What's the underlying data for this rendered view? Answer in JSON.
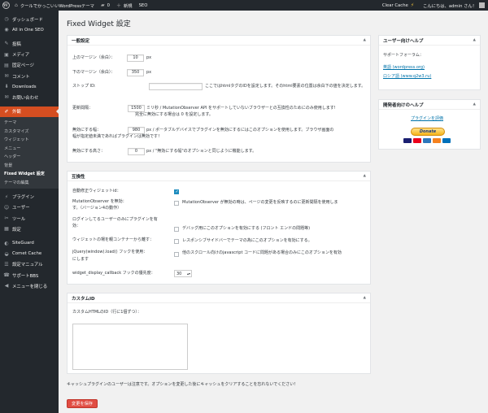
{
  "adminbar": {
    "wp_logo": "W",
    "site_name": "クールでかっこいいWordPressテーマ",
    "comments_count": "0",
    "new_label": "新規",
    "seo_label": "SEO",
    "clear_cache": "Clear Cache",
    "greeting": "こんにちは、admin さん！"
  },
  "sidebar": {
    "items": [
      {
        "label": "ダッシュボード",
        "icon": "dashboard-icon",
        "glyph": "◷"
      },
      {
        "label": "All in One SEO",
        "icon": "seo-icon",
        "glyph": "◉"
      },
      {
        "label": "投稿",
        "icon": "pin-icon",
        "glyph": "✎"
      },
      {
        "label": "メディア",
        "icon": "media-icon",
        "glyph": "▣"
      },
      {
        "label": "固定ページ",
        "icon": "page-icon",
        "glyph": "▤"
      },
      {
        "label": "コメント",
        "icon": "comment-icon",
        "glyph": "✉"
      },
      {
        "label": "Downloads",
        "icon": "download-icon",
        "glyph": "⬇"
      },
      {
        "label": "お問い合わせ",
        "icon": "mail-icon",
        "glyph": "✉"
      },
      {
        "label": "外観",
        "icon": "appearance-icon",
        "glyph": "✐"
      }
    ],
    "submenu": [
      "テーマ",
      "カスタマイズ",
      "ウィジェット",
      "メニュー",
      "ヘッダー",
      "背景",
      "Fixed Widget 設定",
      "テーマの編集"
    ],
    "items2": [
      {
        "label": "プラグイン",
        "icon": "plugin-icon",
        "glyph": "⚡"
      },
      {
        "label": "ユーザー",
        "icon": "user-icon",
        "glyph": "☺"
      },
      {
        "label": "ツール",
        "icon": "tool-icon",
        "glyph": "✂"
      },
      {
        "label": "設定",
        "icon": "settings-icon",
        "glyph": "▦"
      }
    ],
    "items3": [
      {
        "label": "SiteGuard",
        "icon": "siteguard-icon",
        "glyph": "◐"
      },
      {
        "label": "Comet Cache",
        "icon": "cache-icon",
        "glyph": "◒"
      },
      {
        "label": "設定マニュアル",
        "icon": "manual-icon",
        "glyph": "☰"
      },
      {
        "label": "サポートBBS",
        "icon": "support-icon",
        "glyph": "☎"
      },
      {
        "label": "メニューを閉じる",
        "icon": "collapse-icon",
        "glyph": "◀"
      }
    ]
  },
  "page_title": "Fixed Widget 設定",
  "general": {
    "title": "一般設定",
    "toggle": "▲",
    "margin_top_label": "上のマージン（余白）：",
    "margin_top_value": "10",
    "margin_bottom_label": "下のマージン（余白）：",
    "margin_bottom_value": "350",
    "px": "px",
    "stop_id_label": "ストップ ID:",
    "stop_id_value": "",
    "stop_id_desc": "ここではhtmlタグのIDを設定します。そのhtml要素の位置は余白下の値を決定します。",
    "refresh_label": "更新間隔：",
    "refresh_value": "1500",
    "refresh_desc": "ミリ秒 / MutationObserver API をサポートしていないブラウザーとの互換性のためにのみ使用します!",
    "refresh_desc2": "完全に無効にする場合は 0 を設定します。",
    "disable_width_label": "無効にする幅：",
    "disable_width_value": "980",
    "disable_width_desc": "px / ポータブルデバイスでプラグインを無効にするにはこのオプションを使用します。ブラウザ画面の",
    "disable_width_desc2": "幅が指定値未満であればプラグインは無効です！",
    "disable_height_label": "無効にする高さ：",
    "disable_height_value": "0",
    "disable_height_desc": "px / \"無効にする幅\"のオプションと同じように機能します。"
  },
  "compat": {
    "title": "互換性",
    "toggle": "▲",
    "auto_fix_label": "自動修正ウィジェットid：",
    "mutation_label": "MutationObserver を無効：",
    "mutation_label2": "す。（バージョン4の動作）",
    "mutation_desc": "MutationObserver が無効の時は、ページの変更を反映するのに更新間隔を使用しま",
    "logged_label": "ログインしてるユーザーのみにプラグインを有",
    "logged_label2": "効：",
    "logged_desc": "デバッグ用にこのオプションを有効にする (フロント エンドの問題等)",
    "reset_label": "ウィジェットの場を親コンテナーから離す：",
    "reset_desc": "レスポンシブサイドバーでテーマの為にこのオプションを有効にする。",
    "jquery_label": "jQuery(window).load() フックを使用：",
    "jquery_label2": "にします",
    "jquery_desc": "他のスクロール向けのjavascript コードに問題がある場合のみにこのオプションを有効",
    "callback_label": "widget_display_callback フックの優先度：",
    "callback_value": "30"
  },
  "custom": {
    "title": "カスタムID",
    "toggle": "▲",
    "html_id_label": "カスタムHTMLのID（行に1個ずつ）："
  },
  "notice": "キャッシュプラグインのユーザーは注意です。オプションを変更した後にキャッシュをクリアすることを忘れないでください！",
  "save_label": "変更を保存",
  "user_help": {
    "title": "ユーザー向けヘルプ",
    "toggle": "▲",
    "forum_label": "サポートフォーラム：",
    "link1": "英語 (wordpress.org)",
    "link2": "ロシア語 (www.q2w3.ru)"
  },
  "dev_help": {
    "title": "開発者向けのヘルプ",
    "toggle": "▲",
    "rate_link": "プラグインを評価",
    "donate": "Donate"
  }
}
